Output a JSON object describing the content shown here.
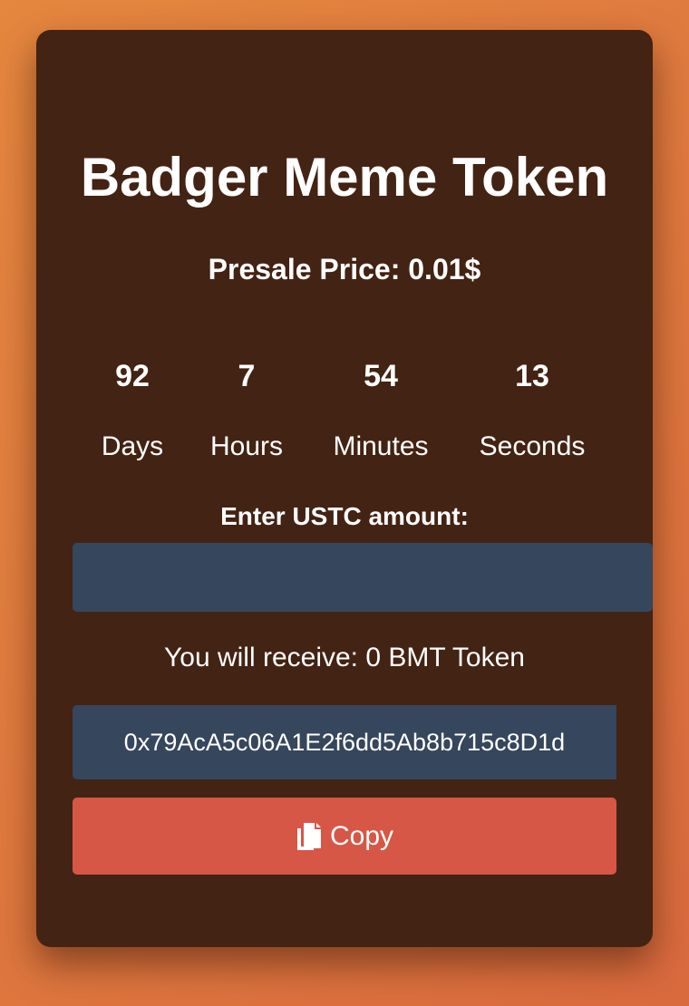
{
  "card": {
    "title": "Badger Meme Token",
    "price_label": "Presale Price: 0.01$"
  },
  "countdown": {
    "days": "92",
    "hours": "7",
    "minutes": "54",
    "seconds": "13",
    "days_label": "Days",
    "hours_label": "Hours",
    "minutes_label": "Minutes",
    "seconds_label": "Seconds"
  },
  "form": {
    "amount_label": "Enter USTC amount:",
    "amount_value": "",
    "receive_text": "You will receive: 0 BMT Token",
    "address": "0x79AcA5c06A1E2f6dd5Ab8b715c8D1d",
    "copy_label": "Copy",
    "copy_icon": "copy-icon"
  },
  "colors": {
    "card_bg": "#432313",
    "input_bg": "#36465c",
    "copy_button": "#d65746"
  }
}
